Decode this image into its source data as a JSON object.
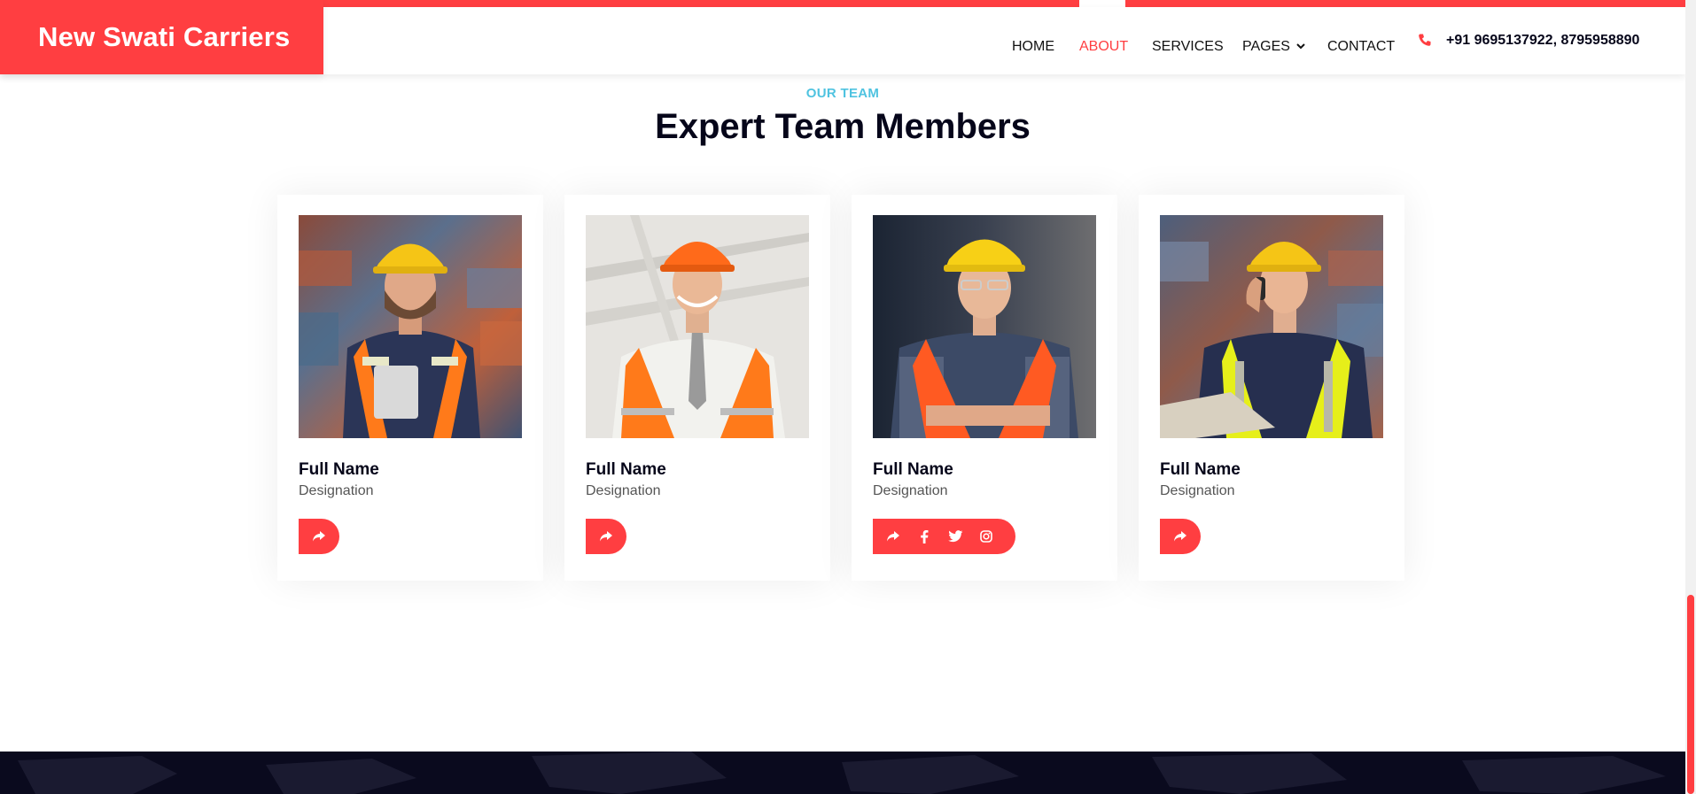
{
  "brand": {
    "name": "New Swati Carriers"
  },
  "nav": {
    "items": [
      {
        "label": "HOME"
      },
      {
        "label": "ABOUT"
      },
      {
        "label": "SERVICES"
      },
      {
        "label": "PAGES"
      },
      {
        "label": "CONTACT"
      }
    ],
    "active": "ABOUT",
    "phone": "+91 9695137922, 8795958890"
  },
  "team": {
    "eyebrow": "OUR TEAM",
    "title": "Expert Team Members",
    "members": [
      {
        "name": "Full Name",
        "designation": "Designation",
        "helmet": "yellow",
        "vest": "orange"
      },
      {
        "name": "Full Name",
        "designation": "Designation",
        "helmet": "orange",
        "vest": "orange"
      },
      {
        "name": "Full Name",
        "designation": "Designation",
        "helmet": "yellow",
        "vest": "orange",
        "social_expanded": true
      },
      {
        "name": "Full Name",
        "designation": "Designation",
        "helmet": "yellow",
        "vest": "yellow"
      }
    ],
    "social_icons": [
      "share-icon",
      "facebook-icon",
      "twitter-icon",
      "instagram-icon"
    ]
  },
  "colors": {
    "accent": "#ff3e41",
    "eyebrow": "#4fc3e0",
    "dark": "#06061a",
    "footer": "#0a0a1e"
  }
}
